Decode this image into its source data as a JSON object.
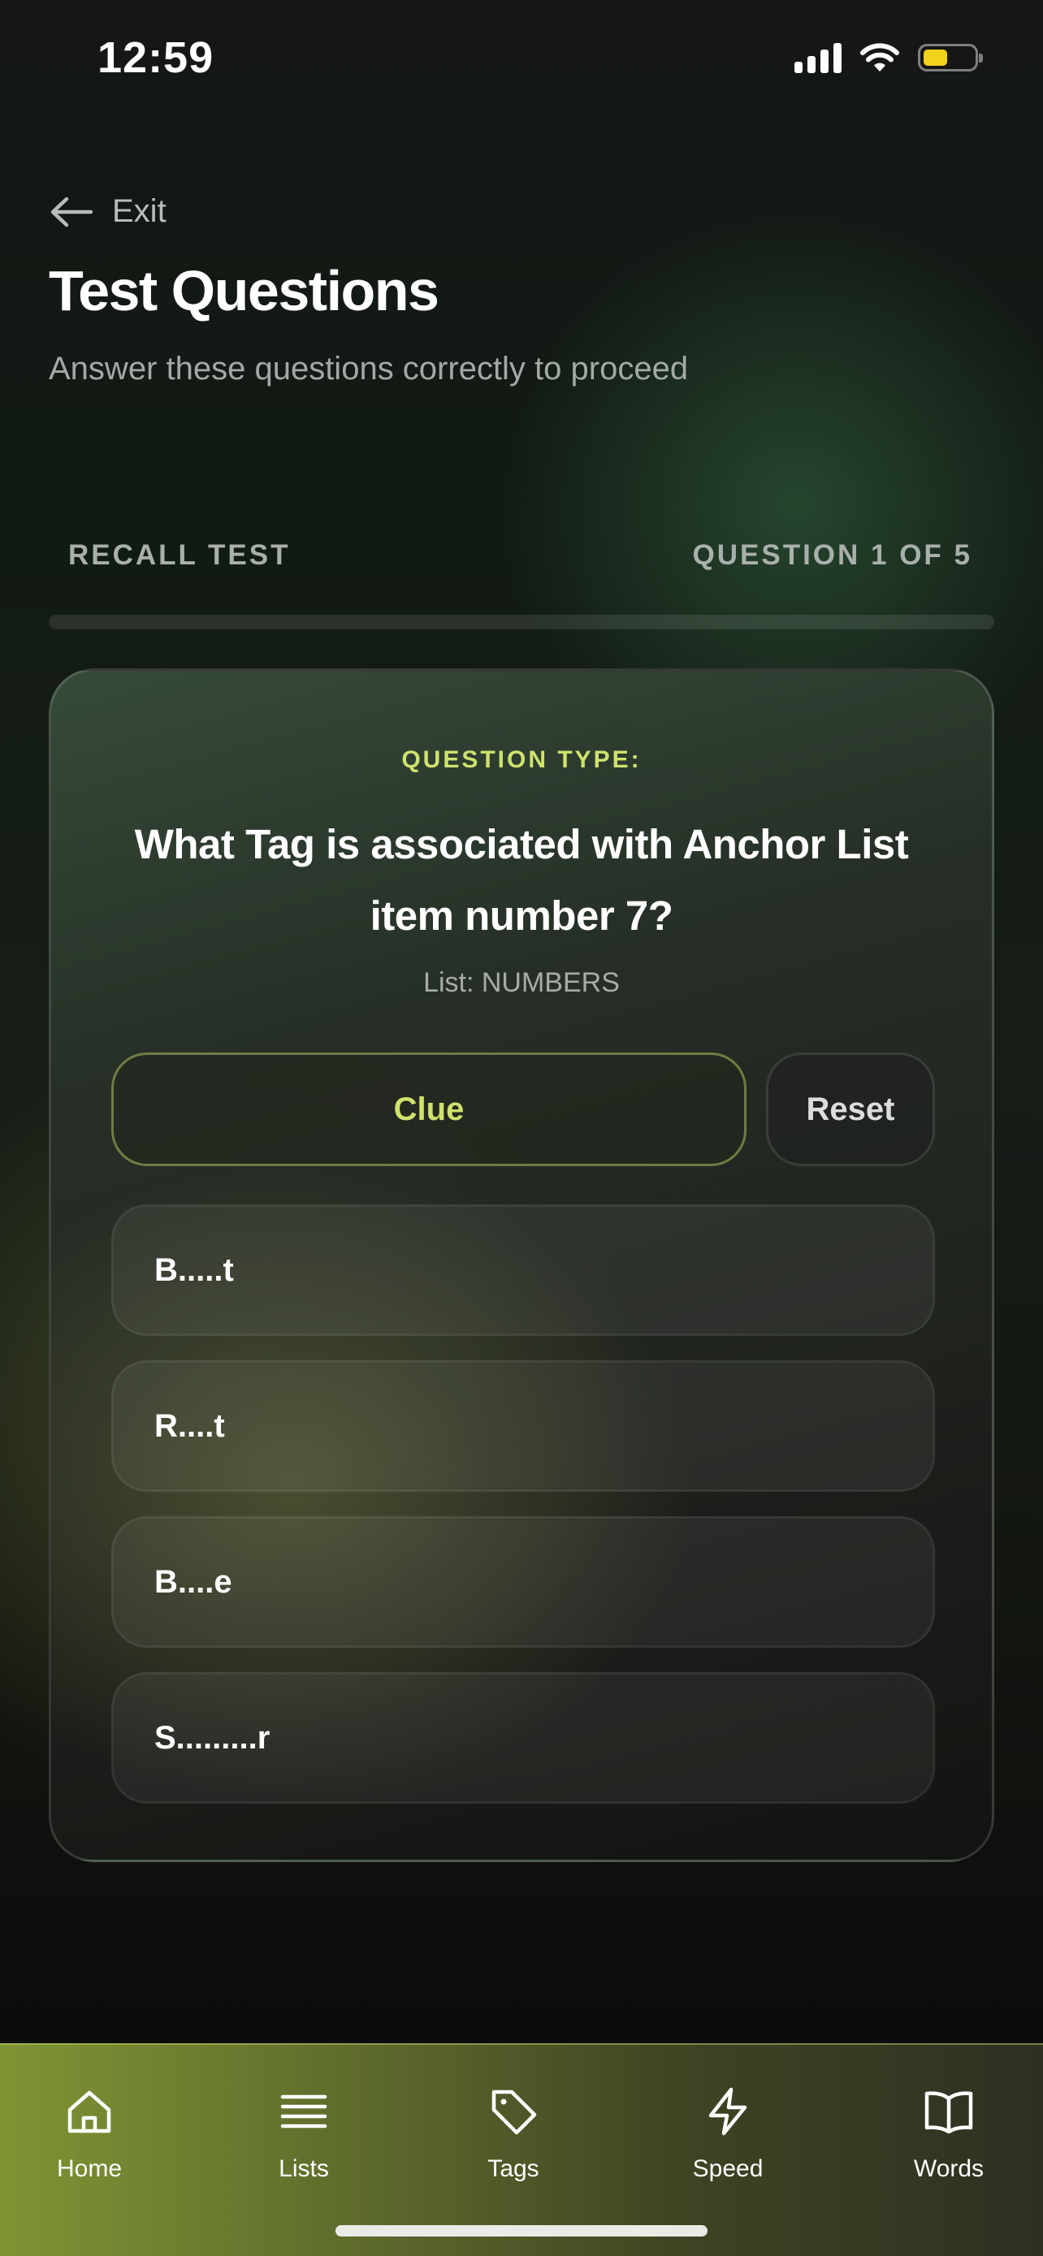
{
  "status_bar": {
    "time": "12:59"
  },
  "header": {
    "exit_label": "Exit",
    "title": "Test Questions",
    "subtitle": "Answer these questions correctly to proceed"
  },
  "progress": {
    "section_label": "RECALL TEST",
    "counter_label": "QUESTION 1 OF 5",
    "current": 1,
    "total": 5
  },
  "question": {
    "type_label": "QUESTION TYPE:",
    "text": "What Tag is associated with Anchor List item number 7?",
    "list_label": "List: NUMBERS",
    "clue_label": "Clue",
    "reset_label": "Reset",
    "options": [
      "B.....t",
      "R....t",
      "B....e",
      "S.........r"
    ]
  },
  "tab_bar": {
    "items": [
      {
        "label": "Home",
        "icon": "home-icon"
      },
      {
        "label": "Lists",
        "icon": "list-icon"
      },
      {
        "label": "Tags",
        "icon": "tag-icon"
      },
      {
        "label": "Speed",
        "icon": "lightning-icon"
      },
      {
        "label": "Words",
        "icon": "book-icon"
      }
    ]
  },
  "colors": {
    "accent": "#cfe26e",
    "battery": "#f2d21b"
  }
}
